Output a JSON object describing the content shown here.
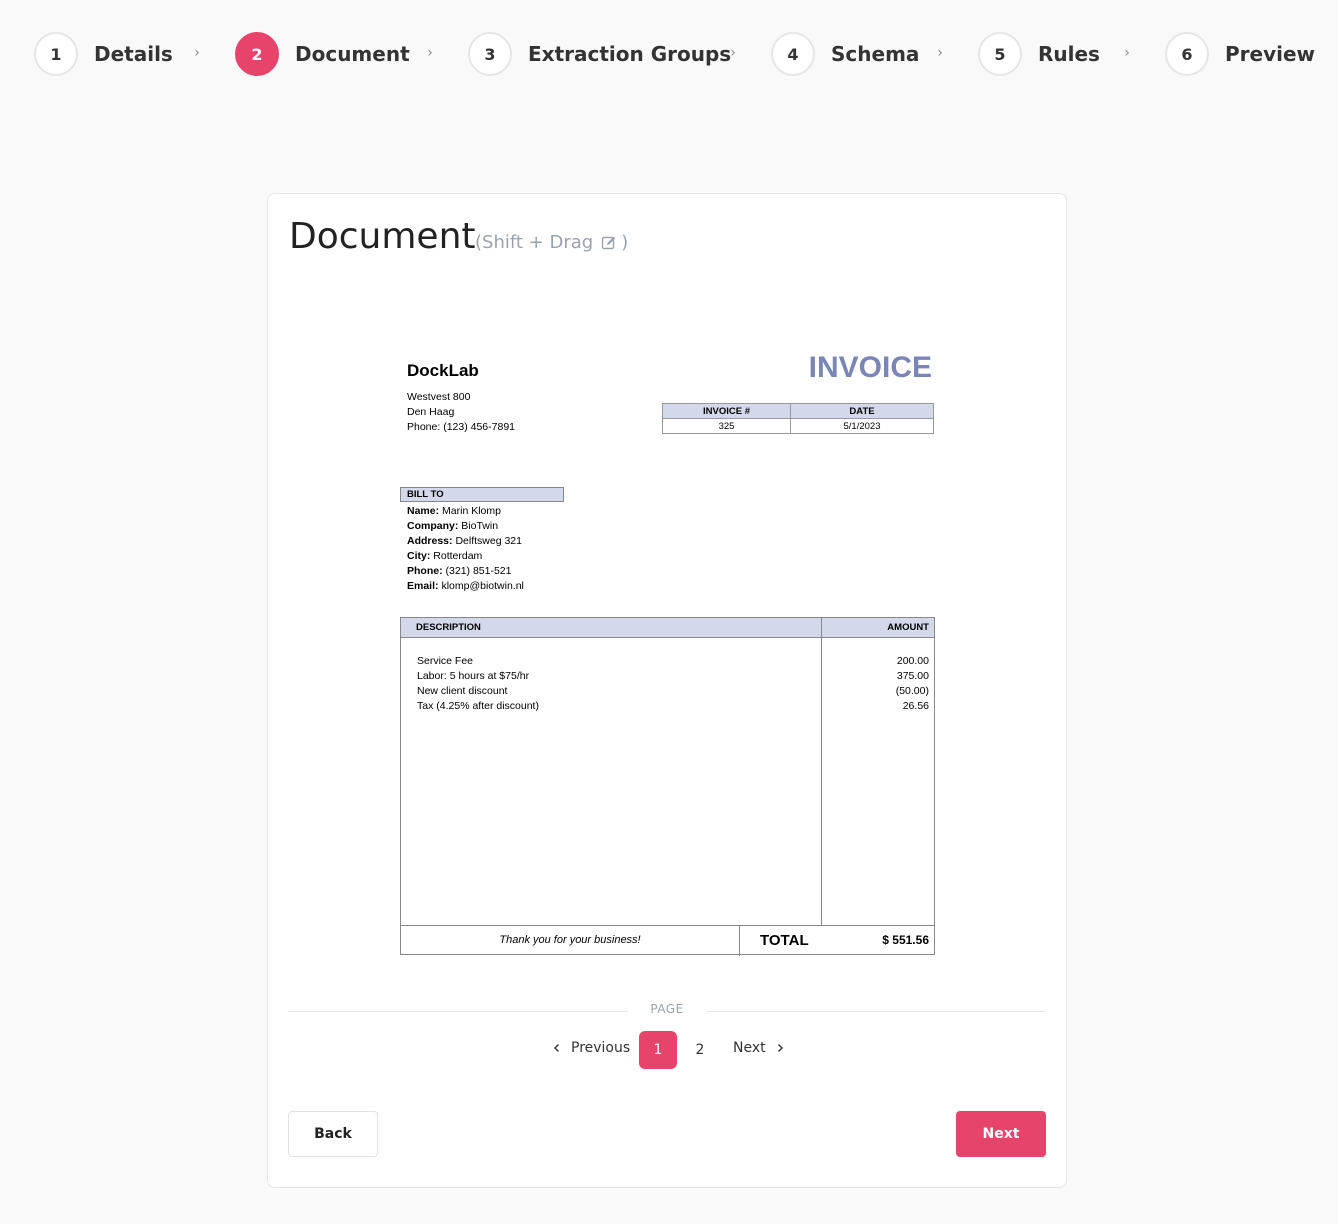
{
  "stepper": {
    "steps": [
      {
        "number": "1",
        "label": "Details"
      },
      {
        "number": "2",
        "label": "Document"
      },
      {
        "number": "3",
        "label": "Extraction Groups"
      },
      {
        "number": "4",
        "label": "Schema"
      },
      {
        "number": "5",
        "label": "Rules"
      },
      {
        "number": "6",
        "label": "Preview"
      }
    ],
    "active_step": 2,
    "separator": "›"
  },
  "card": {
    "title": "Document",
    "hint_prefix": "(Shift + Drag",
    "hint_suffix": ")"
  },
  "invoice": {
    "company": "DockLab",
    "address_lines": [
      "Westvest 800",
      "Den Haag",
      "Phone: (123) 456-7891"
    ],
    "title": "INVOICE",
    "meta": {
      "invoice_no_label": "INVOICE #",
      "date_label": "DATE",
      "invoice_no": "325",
      "date": "5/1/2023"
    },
    "bill_to": {
      "heading": "BILL TO",
      "fields": [
        {
          "label": "Name:",
          "value": "Marin Klomp"
        },
        {
          "label": "Company:",
          "value": "BioTwin"
        },
        {
          "label": "Address:",
          "value": "Delftsweg 321"
        },
        {
          "label": "City:",
          "value": "Rotterdam"
        },
        {
          "label": "Phone:",
          "value": "(321) 851-521"
        },
        {
          "label": "Email:",
          "value": "klomp@biotwin.nl"
        }
      ]
    },
    "items_header": {
      "description": "DESCRIPTION",
      "amount": "AMOUNT"
    },
    "items": [
      {
        "description": "Service Fee",
        "amount": "200.00"
      },
      {
        "description": "Labor: 5 hours at $75/hr",
        "amount": "375.00"
      },
      {
        "description": "New client discount",
        "amount": "(50.00)"
      },
      {
        "description": "Tax (4.25% after discount)",
        "amount": "26.56"
      }
    ],
    "thanks": "Thank you for your business!",
    "total_label": "TOTAL",
    "total_value": "$ 551.56"
  },
  "pagination": {
    "label": "PAGE",
    "previous": "Previous",
    "next": "Next",
    "pages": [
      "1",
      "2"
    ],
    "current_page": "1"
  },
  "actions": {
    "back": "Back",
    "next": "Next"
  },
  "colors": {
    "accent": "#e8436a",
    "invoice_title": "#7a86b8",
    "table_header_bg": "#d3d9ea"
  }
}
